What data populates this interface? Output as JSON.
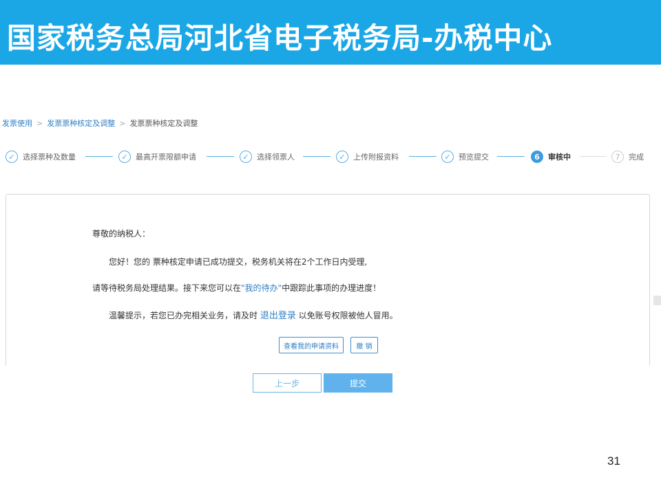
{
  "header": {
    "title": "国家税务总局河北省电子税务局-办税中心"
  },
  "breadcrumb": {
    "items": [
      "发票使用",
      "发票票种核定及调整",
      "发票票种核定及调整"
    ],
    "separator": ">"
  },
  "steps": [
    {
      "label": "选择票种及数量",
      "status": "done",
      "icon": "check-icon"
    },
    {
      "label": "最高开票限额申请",
      "status": "done",
      "icon": "check-icon"
    },
    {
      "label": "选择领票人",
      "status": "done",
      "icon": "check-icon"
    },
    {
      "label": "上传附报资料",
      "status": "done",
      "icon": "check-icon"
    },
    {
      "label": "预览提交",
      "status": "done",
      "icon": "check-icon"
    },
    {
      "label": "审核中",
      "status": "active",
      "number": "6"
    },
    {
      "label": "完成",
      "status": "pending",
      "number": "7"
    }
  ],
  "message": {
    "greeting": "尊敬的纳税人：",
    "line1": "您好！您的 票种核定申请已成功提交，税务机关将在2个工作日内受理,",
    "line2_pre": "请等待税务局处理结果。接下来您可以在",
    "line2_link": "\"我的待办\"",
    "line2_post": "中跟踪此事项的办理进度！",
    "line3_pre": "温馨提示，若您已办完相关业务，请及时 ",
    "line3_link": "退出登录",
    "line3_post": " 以免账号权限被他人冒用。"
  },
  "actions": {
    "view_application": "查看我的申请资料",
    "withdraw": "撤 销",
    "prev": "上一步",
    "submit": "提交"
  },
  "page_number": "31",
  "colors": {
    "banner": "#1ba7e6",
    "accent": "#3d9be0",
    "link": "#2f7fc4"
  }
}
